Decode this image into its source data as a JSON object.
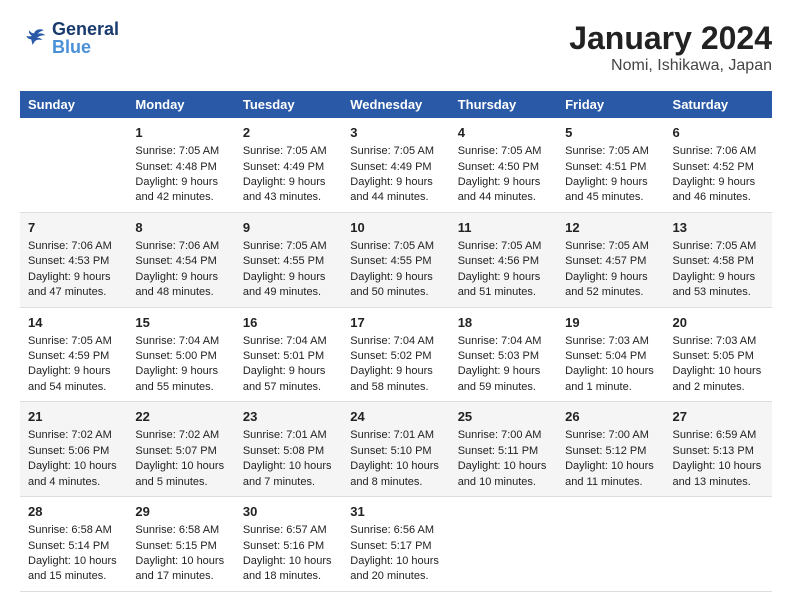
{
  "header": {
    "logo_general": "General",
    "logo_blue": "Blue",
    "title": "January 2024",
    "subtitle": "Nomi, Ishikawa, Japan"
  },
  "days_of_week": [
    "Sunday",
    "Monday",
    "Tuesday",
    "Wednesday",
    "Thursday",
    "Friday",
    "Saturday"
  ],
  "weeks": [
    [
      {
        "day": "",
        "sunrise": "",
        "sunset": "",
        "daylight": ""
      },
      {
        "day": "1",
        "sunrise": "Sunrise: 7:05 AM",
        "sunset": "Sunset: 4:48 PM",
        "daylight": "Daylight: 9 hours and 42 minutes."
      },
      {
        "day": "2",
        "sunrise": "Sunrise: 7:05 AM",
        "sunset": "Sunset: 4:49 PM",
        "daylight": "Daylight: 9 hours and 43 minutes."
      },
      {
        "day": "3",
        "sunrise": "Sunrise: 7:05 AM",
        "sunset": "Sunset: 4:49 PM",
        "daylight": "Daylight: 9 hours and 44 minutes."
      },
      {
        "day": "4",
        "sunrise": "Sunrise: 7:05 AM",
        "sunset": "Sunset: 4:50 PM",
        "daylight": "Daylight: 9 hours and 44 minutes."
      },
      {
        "day": "5",
        "sunrise": "Sunrise: 7:05 AM",
        "sunset": "Sunset: 4:51 PM",
        "daylight": "Daylight: 9 hours and 45 minutes."
      },
      {
        "day": "6",
        "sunrise": "Sunrise: 7:06 AM",
        "sunset": "Sunset: 4:52 PM",
        "daylight": "Daylight: 9 hours and 46 minutes."
      }
    ],
    [
      {
        "day": "7",
        "sunrise": "Sunrise: 7:06 AM",
        "sunset": "Sunset: 4:53 PM",
        "daylight": "Daylight: 9 hours and 47 minutes."
      },
      {
        "day": "8",
        "sunrise": "Sunrise: 7:06 AM",
        "sunset": "Sunset: 4:54 PM",
        "daylight": "Daylight: 9 hours and 48 minutes."
      },
      {
        "day": "9",
        "sunrise": "Sunrise: 7:05 AM",
        "sunset": "Sunset: 4:55 PM",
        "daylight": "Daylight: 9 hours and 49 minutes."
      },
      {
        "day": "10",
        "sunrise": "Sunrise: 7:05 AM",
        "sunset": "Sunset: 4:55 PM",
        "daylight": "Daylight: 9 hours and 50 minutes."
      },
      {
        "day": "11",
        "sunrise": "Sunrise: 7:05 AM",
        "sunset": "Sunset: 4:56 PM",
        "daylight": "Daylight: 9 hours and 51 minutes."
      },
      {
        "day": "12",
        "sunrise": "Sunrise: 7:05 AM",
        "sunset": "Sunset: 4:57 PM",
        "daylight": "Daylight: 9 hours and 52 minutes."
      },
      {
        "day": "13",
        "sunrise": "Sunrise: 7:05 AM",
        "sunset": "Sunset: 4:58 PM",
        "daylight": "Daylight: 9 hours and 53 minutes."
      }
    ],
    [
      {
        "day": "14",
        "sunrise": "Sunrise: 7:05 AM",
        "sunset": "Sunset: 4:59 PM",
        "daylight": "Daylight: 9 hours and 54 minutes."
      },
      {
        "day": "15",
        "sunrise": "Sunrise: 7:04 AM",
        "sunset": "Sunset: 5:00 PM",
        "daylight": "Daylight: 9 hours and 55 minutes."
      },
      {
        "day": "16",
        "sunrise": "Sunrise: 7:04 AM",
        "sunset": "Sunset: 5:01 PM",
        "daylight": "Daylight: 9 hours and 57 minutes."
      },
      {
        "day": "17",
        "sunrise": "Sunrise: 7:04 AM",
        "sunset": "Sunset: 5:02 PM",
        "daylight": "Daylight: 9 hours and 58 minutes."
      },
      {
        "day": "18",
        "sunrise": "Sunrise: 7:04 AM",
        "sunset": "Sunset: 5:03 PM",
        "daylight": "Daylight: 9 hours and 59 minutes."
      },
      {
        "day": "19",
        "sunrise": "Sunrise: 7:03 AM",
        "sunset": "Sunset: 5:04 PM",
        "daylight": "Daylight: 10 hours and 1 minute."
      },
      {
        "day": "20",
        "sunrise": "Sunrise: 7:03 AM",
        "sunset": "Sunset: 5:05 PM",
        "daylight": "Daylight: 10 hours and 2 minutes."
      }
    ],
    [
      {
        "day": "21",
        "sunrise": "Sunrise: 7:02 AM",
        "sunset": "Sunset: 5:06 PM",
        "daylight": "Daylight: 10 hours and 4 minutes."
      },
      {
        "day": "22",
        "sunrise": "Sunrise: 7:02 AM",
        "sunset": "Sunset: 5:07 PM",
        "daylight": "Daylight: 10 hours and 5 minutes."
      },
      {
        "day": "23",
        "sunrise": "Sunrise: 7:01 AM",
        "sunset": "Sunset: 5:08 PM",
        "daylight": "Daylight: 10 hours and 7 minutes."
      },
      {
        "day": "24",
        "sunrise": "Sunrise: 7:01 AM",
        "sunset": "Sunset: 5:10 PM",
        "daylight": "Daylight: 10 hours and 8 minutes."
      },
      {
        "day": "25",
        "sunrise": "Sunrise: 7:00 AM",
        "sunset": "Sunset: 5:11 PM",
        "daylight": "Daylight: 10 hours and 10 minutes."
      },
      {
        "day": "26",
        "sunrise": "Sunrise: 7:00 AM",
        "sunset": "Sunset: 5:12 PM",
        "daylight": "Daylight: 10 hours and 11 minutes."
      },
      {
        "day": "27",
        "sunrise": "Sunrise: 6:59 AM",
        "sunset": "Sunset: 5:13 PM",
        "daylight": "Daylight: 10 hours and 13 minutes."
      }
    ],
    [
      {
        "day": "28",
        "sunrise": "Sunrise: 6:58 AM",
        "sunset": "Sunset: 5:14 PM",
        "daylight": "Daylight: 10 hours and 15 minutes."
      },
      {
        "day": "29",
        "sunrise": "Sunrise: 6:58 AM",
        "sunset": "Sunset: 5:15 PM",
        "daylight": "Daylight: 10 hours and 17 minutes."
      },
      {
        "day": "30",
        "sunrise": "Sunrise: 6:57 AM",
        "sunset": "Sunset: 5:16 PM",
        "daylight": "Daylight: 10 hours and 18 minutes."
      },
      {
        "day": "31",
        "sunrise": "Sunrise: 6:56 AM",
        "sunset": "Sunset: 5:17 PM",
        "daylight": "Daylight: 10 hours and 20 minutes."
      },
      {
        "day": "",
        "sunrise": "",
        "sunset": "",
        "daylight": ""
      },
      {
        "day": "",
        "sunrise": "",
        "sunset": "",
        "daylight": ""
      },
      {
        "day": "",
        "sunrise": "",
        "sunset": "",
        "daylight": ""
      }
    ]
  ]
}
